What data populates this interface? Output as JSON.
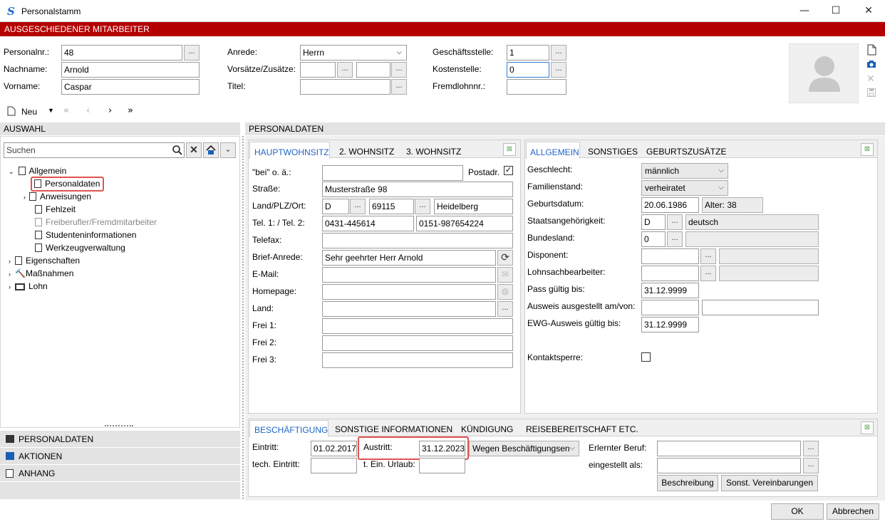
{
  "window": {
    "title": "Personalstamm",
    "minimize": "—",
    "maximize": "☐",
    "close": "✕"
  },
  "banner": "AUSGESCHIEDENER MITARBEITER",
  "header": {
    "personalnr_label": "Personalnr.:",
    "personalnr": "48",
    "nachname_label": "Nachname:",
    "nachname": "Arnold",
    "vorname_label": "Vorname:",
    "vorname": "Caspar",
    "anrede_label": "Anrede:",
    "anrede": "Herrn",
    "vorsaetze_label": "Vorsätze/Zusätze:",
    "titel_label": "Titel:",
    "geschaeftsstelle_label": "Geschäftsstelle:",
    "geschaeftsstelle": "1",
    "kostenstelle_label": "Kostenstelle:",
    "kostenstelle": "0",
    "fremdlohn_label": "Fremdlohnnr.:"
  },
  "dots": "...",
  "toolbar": {
    "new_label": "Neu"
  },
  "left": {
    "section_title": "AUSWAHL",
    "search_placeholder": "Suchen",
    "tree": [
      {
        "label": "Allgemein"
      },
      {
        "label": "Personaldaten"
      },
      {
        "label": "Anweisungen"
      },
      {
        "label": "Fehlzeit"
      },
      {
        "label": "Freiberufler/Fremdmitarbeiter"
      },
      {
        "label": "Studenteninformationen"
      },
      {
        "label": "Werkzeugverwaltung"
      },
      {
        "label": "Eigenschaften"
      },
      {
        "label": "Maßnahmen"
      },
      {
        "label": "Lohn"
      }
    ],
    "nav": [
      {
        "label": "PERSONALDATEN"
      },
      {
        "label": "AKTIONEN"
      },
      {
        "label": "ANHANG"
      }
    ]
  },
  "main": {
    "section_title": "PERSONALDATEN",
    "addr_tabs": [
      {
        "label": "HAUPTWOHNSITZ"
      },
      {
        "label": "2. WOHNSITZ"
      },
      {
        "label": "3. WOHNSITZ"
      }
    ],
    "addr": {
      "bei_label": "\"bei\" o. ä.:",
      "postadr_label": "Postadr.",
      "strasse_label": "Straße:",
      "strasse": "Musterstraße 98",
      "land_plz_ort_label": "Land/PLZ/Ort:",
      "land": "D",
      "plz": "69115",
      "ort": "Heidelberg",
      "tel_label": "Tel. 1: / Tel. 2:",
      "tel1": "0431-445614",
      "tel2": "0151-987654224",
      "telefax_label": "Telefax:",
      "briefanrede_label": "Brief-Anrede:",
      "briefanrede": "Sehr geehrter Herr Arnold",
      "email_label": "E-Mail:",
      "homepage_label": "Homepage:",
      "land2_label": "Land:",
      "frei1_label": "Frei 1:",
      "frei2_label": "Frei 2:",
      "frei3_label": "Frei 3:"
    },
    "gen_tabs": [
      {
        "label": "ALLGEMEIN"
      },
      {
        "label": "SONSTIGES"
      },
      {
        "label": "GEBURTSZUSÄTZE"
      }
    ],
    "gen": {
      "geschlecht_label": "Geschlecht:",
      "geschlecht": "männlich",
      "familienstand_label": "Familienstand:",
      "familienstand": "verheiratet",
      "geburtsdatum_label": "Geburtsdatum:",
      "geburtsdatum": "20.06.1986",
      "alter": "Alter: 38",
      "staat_label": "Staatsangehörigkeit:",
      "staat_code": "D",
      "staat": "deutsch",
      "bundesland_label": "Bundesland:",
      "bundesland": "0",
      "disponent_label": "Disponent:",
      "lohnsach_label": "Lohnsachbearbeiter:",
      "pass_label": "Pass gültig bis:",
      "pass": "31.12.9999",
      "ausweis_label": "Ausweis ausgestellt am/von:",
      "ewg_label": "EWG-Ausweis gültig bis:",
      "ewg": "31.12.9999",
      "kontakt_label": "Kontaktsperre:"
    },
    "emp_tabs": [
      {
        "label": "BESCHÄFTIGUNG"
      },
      {
        "label": "SONSTIGE INFORMATIONEN"
      },
      {
        "label": "KÜNDIGUNG"
      },
      {
        "label": "REISEBEREITSCHAFT ETC."
      }
    ],
    "emp": {
      "eintritt_label": "Eintritt:",
      "eintritt": "01.02.2017",
      "austritt_label": "Austritt:",
      "austritt": "31.12.2023",
      "grund": "Wegen Beschäftigungsen",
      "techeintritt_label": "tech. Eintritt:",
      "urlaub_label": "t. Ein. Urlaub:",
      "beruf_label": "Erlernter Beruf:",
      "eingestellt_label": "eingestellt als:",
      "beschreibung_btn": "Beschreibung",
      "vereinbarungen_btn": "Sonst. Vereinbarungen"
    }
  },
  "footer": {
    "ok": "OK",
    "cancel": "Abbrechen"
  },
  "colors": {
    "banner": "#b40000",
    "accent": "#1f64c8",
    "highlight": "#e0534f"
  }
}
